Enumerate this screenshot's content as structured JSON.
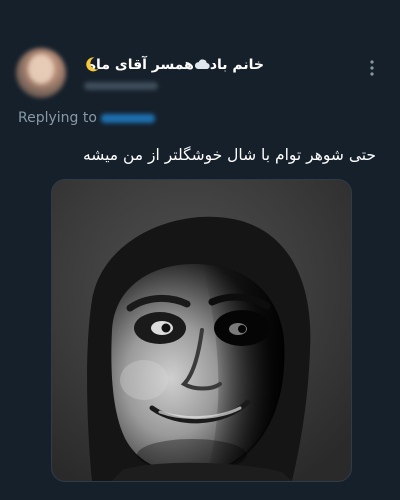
{
  "tweet": {
    "display_name": "خانم باد☁️همسر آقای ماه",
    "name_part1": "خانم باد",
    "name_part2": "همسر آقای ماه",
    "name_icons": [
      "cloud-icon",
      "moon-icon"
    ],
    "replying_label": "Replying to",
    "text": "حتی شوهر توام با شال خوشگلتر از من میشه",
    "media": {
      "description_icon": "meme-image",
      "colors": {
        "background": "#3a3a3a",
        "face_light": "#bdbdbd",
        "face_dark": "#141414"
      }
    }
  },
  "colors": {
    "page_background": "#15202b",
    "secondary_text": "#8899a6",
    "link": "#1d9bf0"
  },
  "icons": {
    "more": "more-vertical-icon"
  }
}
